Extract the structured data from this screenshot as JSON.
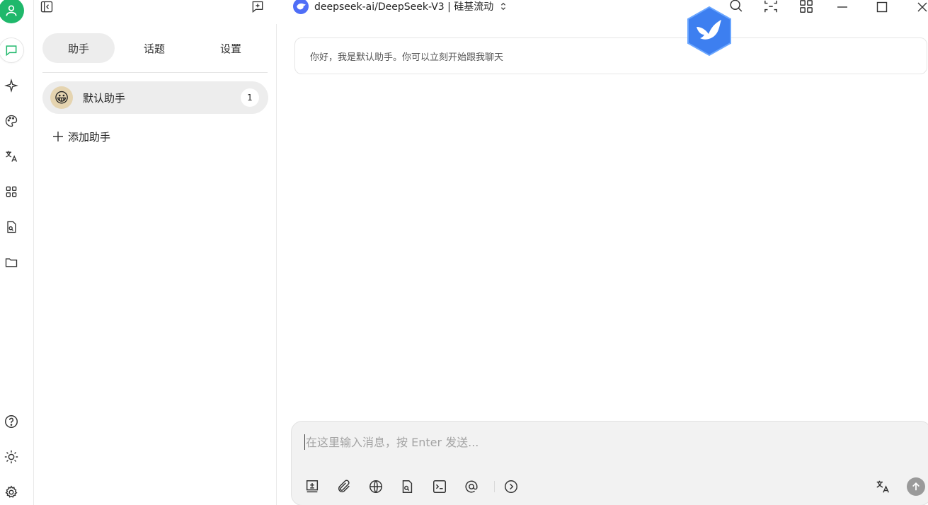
{
  "topbar": {
    "model_label": "deepseek-ai/DeepSeek-V3 | 硅基流动",
    "icons": [
      "sidebar-toggle-icon",
      "new-topic-icon",
      "search-icon",
      "fullscreen-icon",
      "apps-icon",
      "minimize-icon",
      "maximize-icon",
      "close-icon"
    ]
  },
  "rail": {
    "items": [
      "chat-icon",
      "sparkle-icon",
      "palette-icon",
      "translate-icon",
      "apps-icon",
      "file-search-icon",
      "folder-icon"
    ],
    "bottom": [
      "help-icon",
      "theme-icon",
      "settings-icon"
    ]
  },
  "panel": {
    "tabs": [
      {
        "label": "助手",
        "active": true
      },
      {
        "label": "话题",
        "active": false
      },
      {
        "label": "设置",
        "active": false
      }
    ],
    "assistant": {
      "emoji": "😀",
      "name": "默认助手",
      "count": "1"
    },
    "add_label": "添加助手"
  },
  "chat": {
    "greeting": "你好，我是默认助手。你可以立刻开始跟我聊天"
  },
  "composer": {
    "placeholder": "在这里输入消息，按 Enter 发送..."
  },
  "colors": {
    "accent_green": "#1fb86b",
    "model_blue": "#4f6ef7",
    "tab_active_bg": "#ededed"
  }
}
